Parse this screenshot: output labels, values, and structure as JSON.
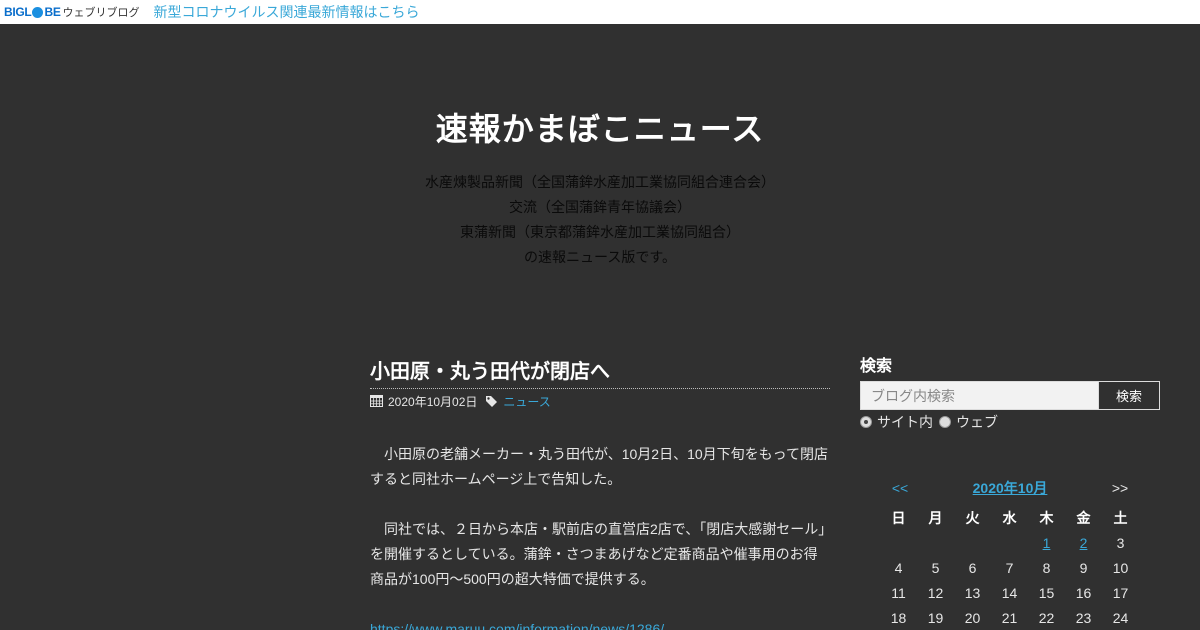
{
  "topbar": {
    "logo_big": "BIGL",
    "logo_be": "BE",
    "logo_sub": "ウェブリブログ",
    "notice": "新型コロナウイルス関連最新情報はこちら"
  },
  "site": {
    "title": "速報かまぼこニュース",
    "desc": [
      "水産煉製品新聞（全国蒲鉾水産加工業協同組合連合会）",
      "交流（全国蒲鉾青年協議会）",
      "東蒲新聞（東京都蒲鉾水産加工業協同組合）",
      "の速報ニュース版です。"
    ]
  },
  "post": {
    "title": "小田原・丸う田代が閉店へ",
    "date": "2020年10月02日",
    "category": "ニュース",
    "paragraphs": [
      "　小田原の老舗メーカー・丸う田代が、10月2日、10月下旬をもって閉店すると同社ホームページ上で告知した。",
      "　同社では、２日から本店・駅前店の直営店2店で、「閉店大感謝セール」を開催するとしている。蒲鉾・さつまあげなど定番商品や催事用のお得商品が100円～500円の超大特価で提供する。"
    ],
    "link": "https://www.maruu.com/information/news/1286/"
  },
  "sidebar": {
    "search_title": "検索",
    "search_placeholder": "ブログ内検索",
    "search_button": "検索",
    "radio_site": "サイト内",
    "radio_web": "ウェブ"
  },
  "calendar": {
    "prev": "<<",
    "next": ">>",
    "month": "2020年10月",
    "weekdays": [
      "日",
      "月",
      "火",
      "水",
      "木",
      "金",
      "土"
    ],
    "rows": [
      [
        "",
        "",
        "",
        "",
        "1",
        "2",
        "3"
      ],
      [
        "4",
        "5",
        "6",
        "7",
        "8",
        "9",
        "10"
      ],
      [
        "11",
        "12",
        "13",
        "14",
        "15",
        "16",
        "17"
      ],
      [
        "18",
        "19",
        "20",
        "21",
        "22",
        "23",
        "24"
      ]
    ],
    "linked_days": [
      "1",
      "2"
    ]
  },
  "colors": {
    "background": "#303030",
    "link": "#3aa8d8",
    "topbar": "#ffffff"
  }
}
